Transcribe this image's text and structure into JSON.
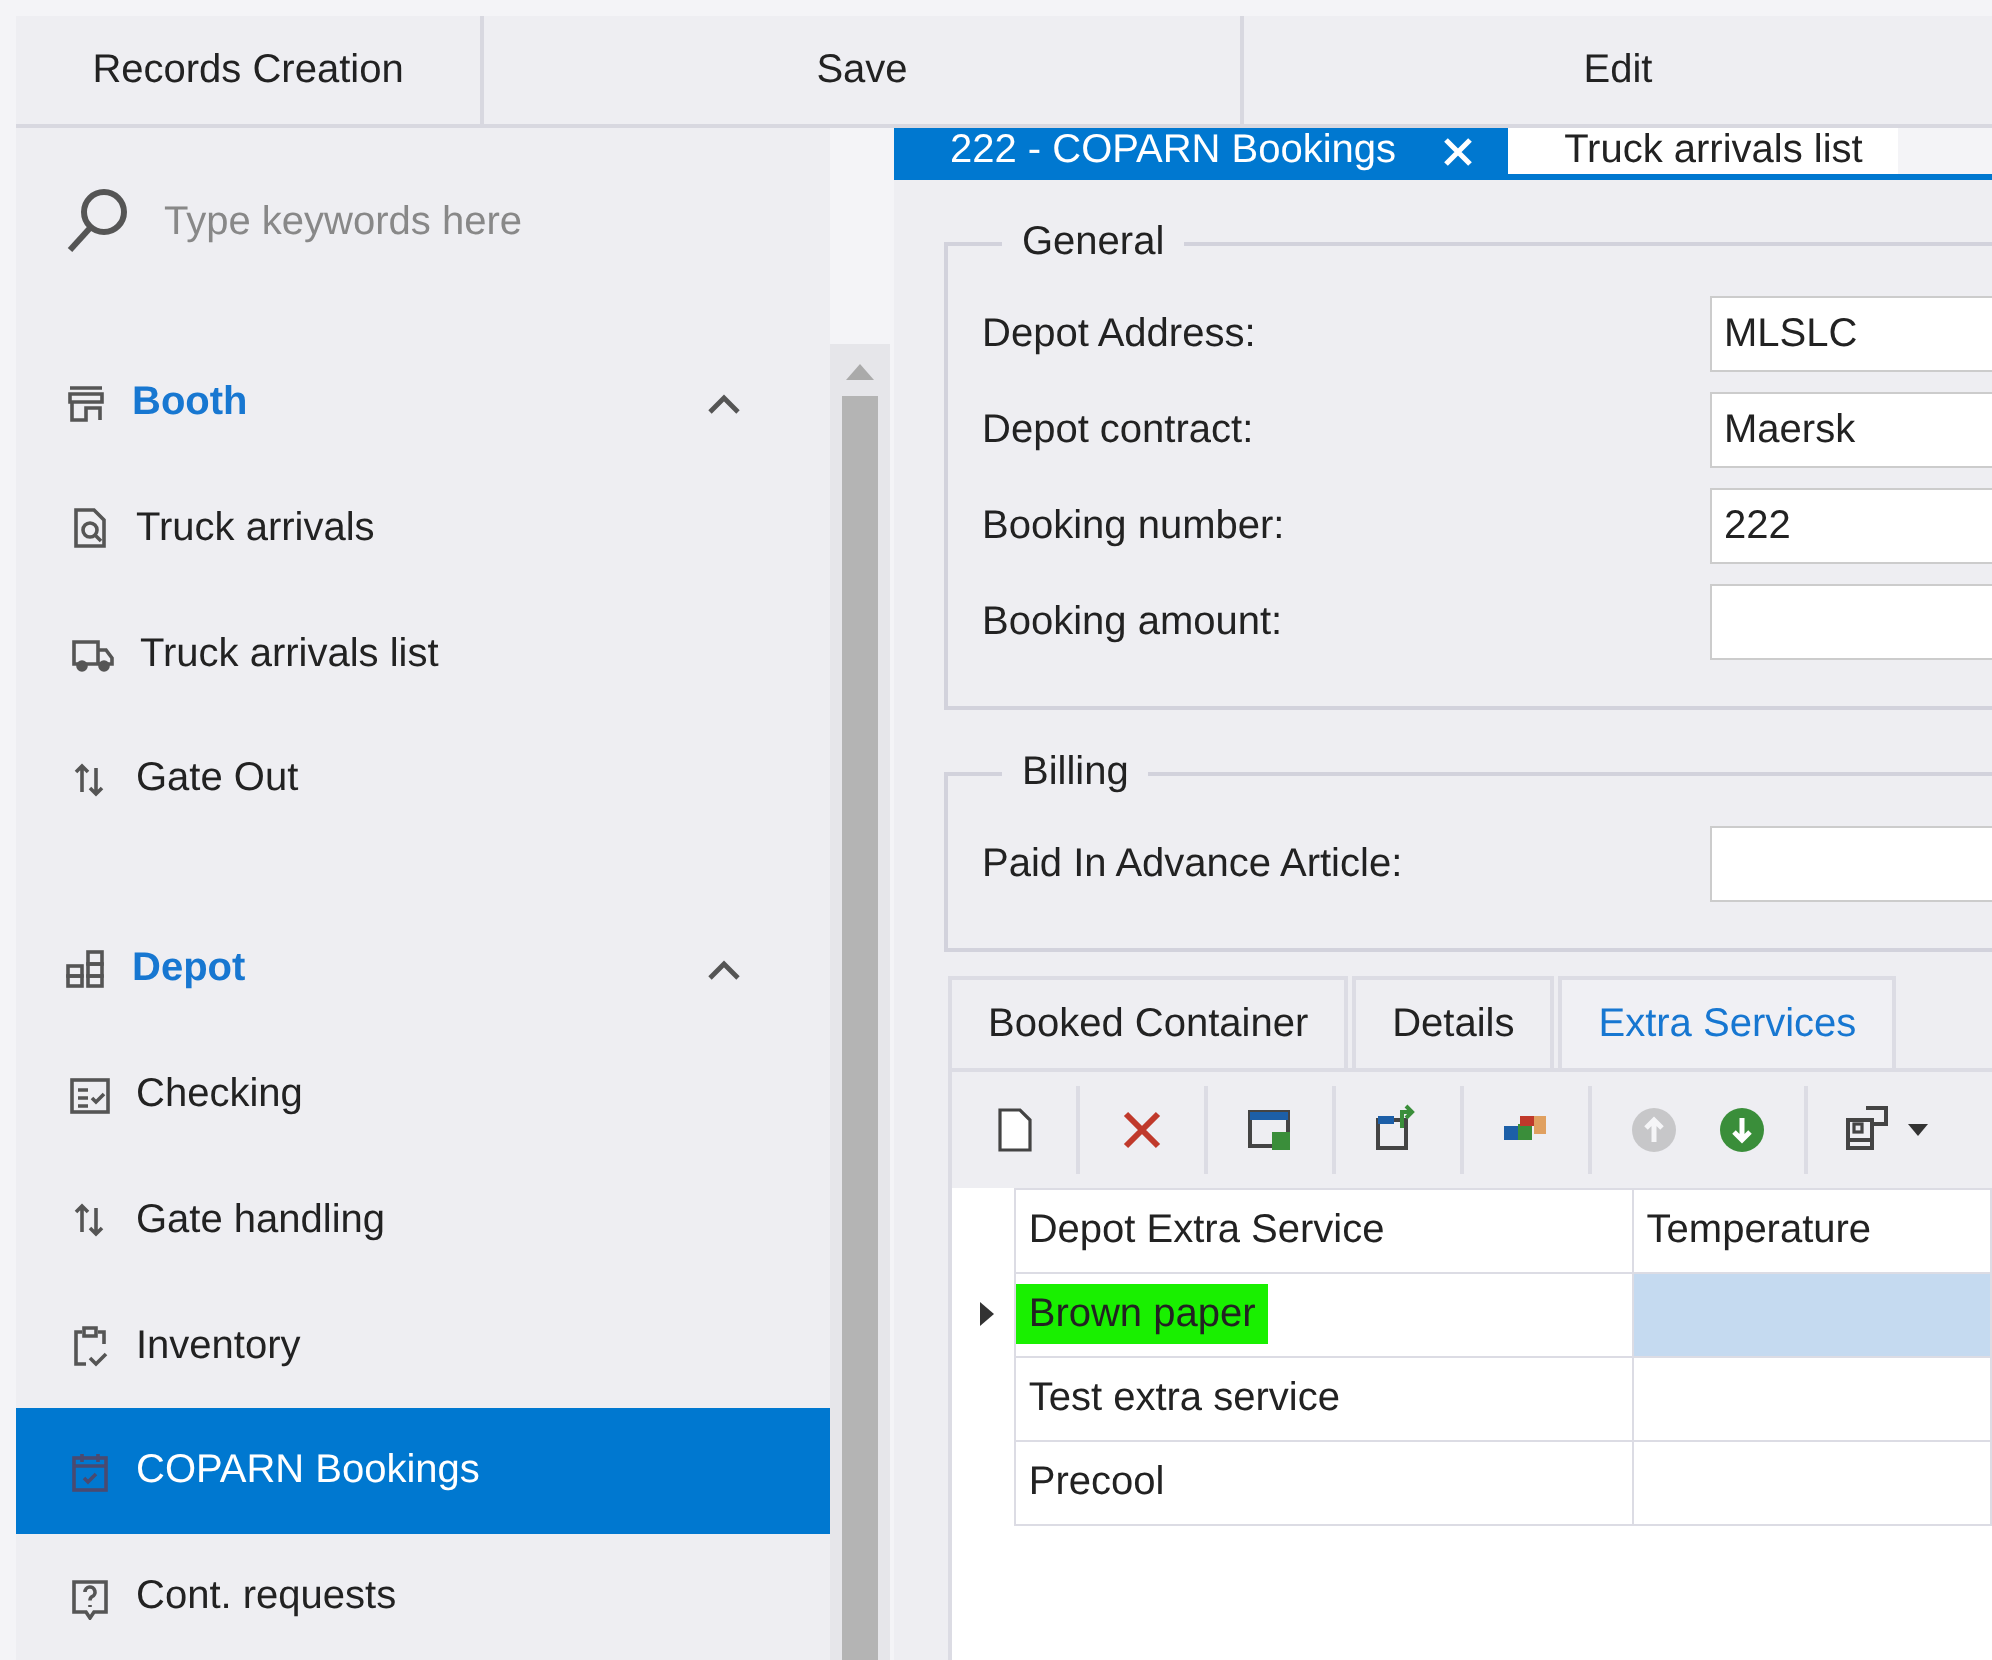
{
  "top_bar": {
    "buttons": [
      "Records Creation",
      "Save",
      "Edit"
    ]
  },
  "sidebar": {
    "search": {
      "placeholder": "Type keywords here"
    },
    "groups": [
      {
        "title": "Booth",
        "kind": "booth",
        "expanded": true,
        "items": [
          {
            "label": "Truck arrivals",
            "kind": "doc-search",
            "selected": false
          },
          {
            "label": "Truck arrivals list",
            "kind": "truck",
            "selected": false
          },
          {
            "label": "Gate Out",
            "kind": "arrows",
            "selected": false
          }
        ]
      },
      {
        "title": "Depot",
        "kind": "depot",
        "expanded": true,
        "items": [
          {
            "label": "Checking",
            "kind": "checklist",
            "selected": false
          },
          {
            "label": "Gate handling",
            "kind": "arrows",
            "selected": false
          },
          {
            "label": "Inventory",
            "kind": "clipboard",
            "selected": false
          },
          {
            "label": "COPARN Bookings",
            "kind": "calendar",
            "selected": true
          },
          {
            "label": "Cont. requests",
            "kind": "question",
            "selected": false
          }
        ]
      }
    ]
  },
  "document_tabs": [
    {
      "label": "222 - COPARN Bookings",
      "selected": true,
      "closable": true
    },
    {
      "label": "Truck arrivals list",
      "selected": false,
      "closable": false
    }
  ],
  "general": {
    "title": "General",
    "fields": [
      {
        "label": "Depot Address:",
        "value": "MLSLC"
      },
      {
        "label": "Depot contract:",
        "value": "Maersk"
      },
      {
        "label": "Booking number:",
        "value": "222"
      },
      {
        "label": "Booking amount:"
      }
    ]
  },
  "billing": {
    "title": "Billing",
    "fields": [
      {
        "label": "Paid In Advance Article:"
      }
    ]
  },
  "detail_tabs": [
    {
      "label": "Booked Container",
      "selected": false
    },
    {
      "label": "Details",
      "selected": false
    },
    {
      "label": "Extra Services",
      "selected": true
    }
  ],
  "toolbar": [
    [
      {
        "kind": "new",
        "disabled": false
      }
    ],
    [
      {
        "kind": "delete",
        "disabled": false
      }
    ],
    [
      {
        "kind": "window",
        "disabled": false
      }
    ],
    [
      {
        "kind": "export",
        "disabled": false
      }
    ],
    [
      {
        "kind": "blocks",
        "disabled": false
      }
    ],
    [
      {
        "kind": "up",
        "disabled": true
      },
      {
        "kind": "down",
        "disabled": false
      }
    ],
    [
      {
        "kind": "layout",
        "disabled": false
      }
    ]
  ],
  "grid": {
    "columns": [
      "Depot Extra Service",
      "Temperature"
    ],
    "rows": [
      {
        "depot_extra_service": "Brown paper",
        "selected": true,
        "highlighted": true
      },
      {
        "depot_extra_service": "Test extra service",
        "selected": false,
        "highlighted": false
      },
      {
        "depot_extra_service": "Precool",
        "selected": false,
        "highlighted": false
      }
    ]
  }
}
